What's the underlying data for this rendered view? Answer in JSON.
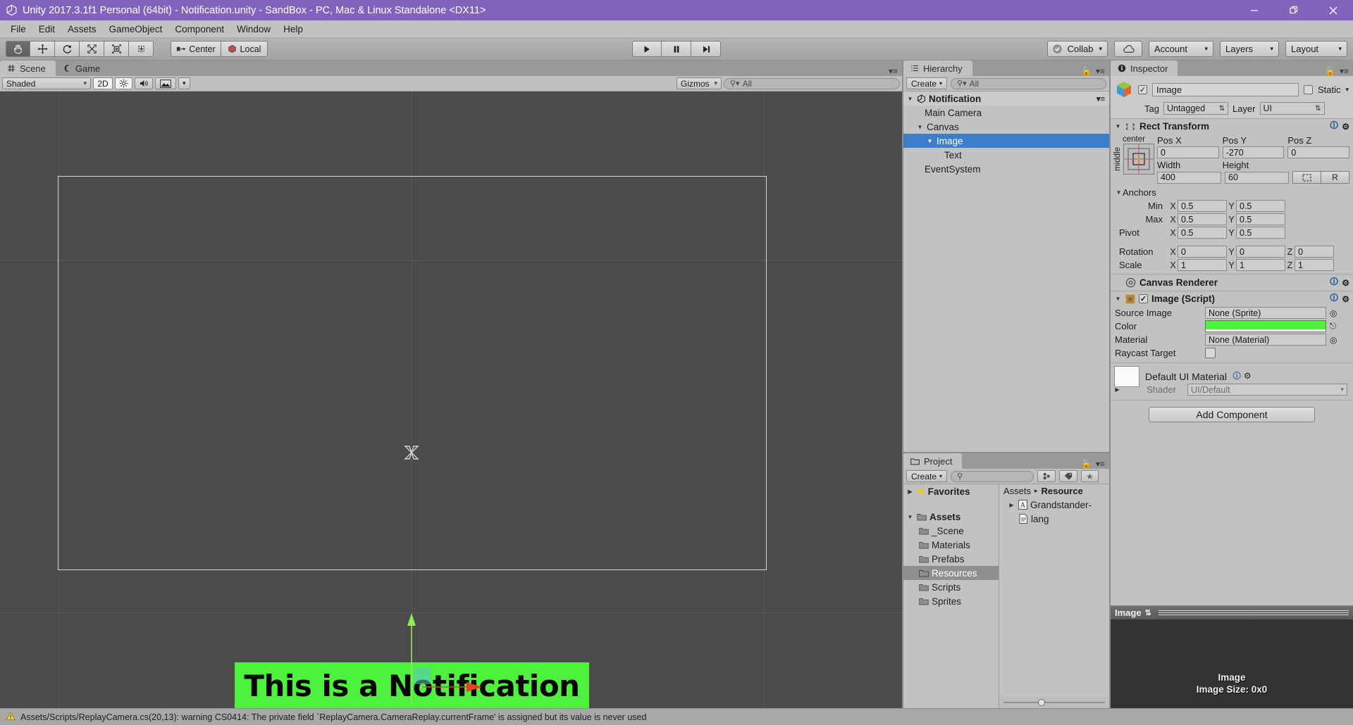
{
  "window": {
    "title": "Unity 2017.3.1f1 Personal (64bit) - Notification.unity - SandBox - PC, Mac & Linux Standalone <DX11>",
    "minimize": "—",
    "maximize": "❐",
    "close": "✕",
    "titlebar_color": "#8163bd"
  },
  "menu": {
    "items": [
      "File",
      "Edit",
      "Assets",
      "GameObject",
      "Component",
      "Window",
      "Help"
    ]
  },
  "toolbar": {
    "tools": [
      {
        "name": "hand-tool",
        "active": true
      },
      {
        "name": "move-tool",
        "active": false
      },
      {
        "name": "rotate-tool",
        "active": false
      },
      {
        "name": "scale-tool",
        "active": false
      },
      {
        "name": "rect-tool",
        "active": false
      },
      {
        "name": "transform-tool",
        "active": false
      }
    ],
    "pivot_mode": "Center",
    "pivot_rotation": "Local",
    "play": "▶",
    "pause": "‖",
    "step": "▶|",
    "collab": "Collab",
    "cloud": "cloud",
    "account": "Account",
    "layers": "Layers",
    "layout": "Layout",
    "caret": "▾"
  },
  "scene": {
    "tabs": [
      {
        "label": "Scene",
        "icon": "grid-icon",
        "active": true
      },
      {
        "label": "Game",
        "icon": "gamepad-icon",
        "active": false
      }
    ],
    "draw_mode": "Shaded",
    "mode_2d": "2D",
    "lighting_icon": "sun-icon",
    "audio_icon": "speaker-icon",
    "effects_icon": "image-icon",
    "gizmos": "Gizmos",
    "search_placeholder": "All",
    "search_value": "",
    "notification_text": "This is a Notification",
    "notification_color": "#4ef23c"
  },
  "hierarchy": {
    "tab": "Hierarchy",
    "create": "Create",
    "search_placeholder": "All",
    "search_value": "",
    "items": [
      {
        "label": "Notification",
        "depth": 0,
        "expanded": true,
        "selected": false,
        "scene_root": true
      },
      {
        "label": "Main Camera",
        "depth": 1,
        "expanded": null,
        "selected": false
      },
      {
        "label": "Canvas",
        "depth": 1,
        "expanded": true,
        "selected": false
      },
      {
        "label": "Image",
        "depth": 2,
        "expanded": true,
        "selected": true
      },
      {
        "label": "Text",
        "depth": 3,
        "expanded": null,
        "selected": false
      },
      {
        "label": "EventSystem",
        "depth": 1,
        "expanded": null,
        "selected": false
      }
    ]
  },
  "project": {
    "tab": "Project",
    "create": "Create",
    "search_value": "",
    "tree": [
      {
        "label": "Favorites",
        "depth": 0,
        "icon": "star-icon",
        "bold": true,
        "expanded": false,
        "selected": false
      },
      {
        "label": "Assets",
        "depth": 0,
        "icon": "folder-icon",
        "bold": true,
        "expanded": true,
        "selected": false
      },
      {
        "label": "_Scene",
        "depth": 1,
        "icon": "folder-icon",
        "bold": false,
        "selected": false
      },
      {
        "label": "Materials",
        "depth": 1,
        "icon": "folder-icon",
        "bold": false,
        "selected": false
      },
      {
        "label": "Prefabs",
        "depth": 1,
        "icon": "folder-icon",
        "bold": false,
        "selected": false
      },
      {
        "label": "Resources",
        "depth": 1,
        "icon": "folder-icon",
        "bold": false,
        "selected": true
      },
      {
        "label": "Scripts",
        "depth": 1,
        "icon": "folder-icon",
        "bold": false,
        "selected": false
      },
      {
        "label": "Sprites",
        "depth": 1,
        "icon": "folder-icon",
        "bold": false,
        "selected": false
      }
    ],
    "breadcrumb": [
      "Assets",
      "Resource"
    ],
    "breadcrumb_sep": "▸",
    "files": [
      {
        "label": "Grandstander-",
        "icon": "font-icon",
        "expandable": true
      },
      {
        "label": "lang",
        "icon": "text-asset-icon",
        "expandable": false
      }
    ]
  },
  "inspector": {
    "tab": "Inspector",
    "object_enabled": true,
    "object_name": "Image",
    "static_label": "Static",
    "static_checked": false,
    "tag_label": "Tag",
    "tag_value": "Untagged",
    "layer_label": "Layer",
    "layer_value": "UI",
    "rect_transform": {
      "title": "Rect Transform",
      "anchor_preset_h": "center",
      "anchor_preset_v": "middle",
      "headers": [
        "Pos X",
        "Pos Y",
        "Pos Z"
      ],
      "pos": [
        "0",
        "-270",
        "0"
      ],
      "size_headers": [
        "Width",
        "Height"
      ],
      "size": [
        "400",
        "60"
      ],
      "blueprint_btn": "⬚",
      "raw_btn": "R",
      "anchors_label": "Anchors",
      "min_label": "Min",
      "min": {
        "x": "0.5",
        "y": "0.5"
      },
      "max_label": "Max",
      "max": {
        "x": "0.5",
        "y": "0.5"
      },
      "pivot_label": "Pivot",
      "pivot": {
        "x": "0.5",
        "y": "0.5"
      },
      "rotation_label": "Rotation",
      "rotation": {
        "x": "0",
        "y": "0",
        "z": "0"
      },
      "scale_label": "Scale",
      "scale": {
        "x": "1",
        "y": "1",
        "z": "1"
      }
    },
    "canvas_renderer": {
      "title": "Canvas Renderer"
    },
    "image_script": {
      "title": "Image (Script)",
      "enabled": true,
      "source_image_label": "Source Image",
      "source_image_value": "None (Sprite)",
      "color_label": "Color",
      "color_value": "#4ef23c",
      "material_label": "Material",
      "material_value": "None (Material)",
      "raycast_label": "Raycast Target",
      "raycast_checked": false
    },
    "material": {
      "title": "Default UI Material",
      "shader_label": "Shader",
      "shader_value": "UI/Default"
    },
    "add_component": "Add Component",
    "preview": {
      "title": "Image",
      "line1": "Image",
      "line2": "Image Size: 0x0"
    }
  },
  "status": {
    "icon": "warning-icon",
    "message": "Assets/Scripts/ReplayCamera.cs(20,13): warning CS0414: The private field `ReplayCamera.CameraReplay.currentFrame' is assigned but its value is never used"
  }
}
